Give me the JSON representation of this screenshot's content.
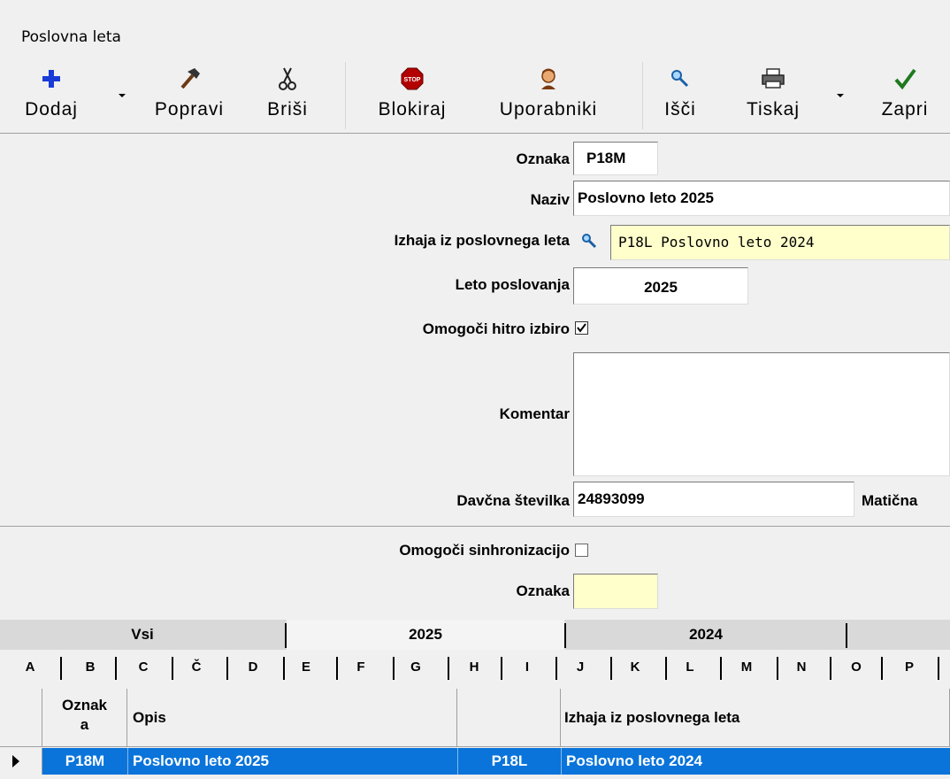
{
  "window": {
    "title": "Poslovna leta"
  },
  "toolbar": {
    "add": "Dodaj",
    "edit": "Popravi",
    "delete": "Briši",
    "block": "Blokiraj",
    "users": "Uporabniki",
    "search": "Išči",
    "print": "Tiskaj",
    "close": "Zapri"
  },
  "form": {
    "oznaka_label": "Oznaka",
    "oznaka_value": "P18M",
    "naziv_label": "Naziv",
    "naziv_value": "Poslovno leto 2025",
    "izhaja_label": "Izhaja iz poslovnega leta",
    "izhaja_value": "P18L Poslovno leto 2024",
    "leto_label": "Leto poslovanja",
    "leto_value": "2025",
    "hitro_label": "Omogoči hitro izbiro",
    "hitro_checked": true,
    "komentar_label": "Komentar",
    "komentar_value": "",
    "davcna_label": "Davčna številka",
    "davcna_value": "24893099",
    "maticna_label": "Matična",
    "sinhro_label": "Omogoči sinhronizacijo",
    "sinhro_checked": false,
    "oznaka2_label": "Oznaka",
    "oznaka2_value": ""
  },
  "tabs": [
    "Vsi",
    "2025",
    "2024"
  ],
  "letters": [
    "A",
    "B",
    "C",
    "Č",
    "D",
    "E",
    "F",
    "G",
    "H",
    "I",
    "J",
    "K",
    "L",
    "M",
    "N",
    "O",
    "P"
  ],
  "grid": {
    "headers": {
      "oznaka": "Oznak a",
      "opis": "Opis",
      "code": "",
      "izhaja": "Izhaja iz poslovnega leta"
    },
    "rows": [
      {
        "oznaka": "P18M",
        "opis": "Poslovno leto 2025",
        "code": "P18L",
        "izhaja": "Poslovno leto 2024"
      }
    ]
  },
  "colors": {
    "selection": "#0a74da",
    "lookup_bg": "#ffffcc",
    "window_bg": "#f0f0f0"
  }
}
